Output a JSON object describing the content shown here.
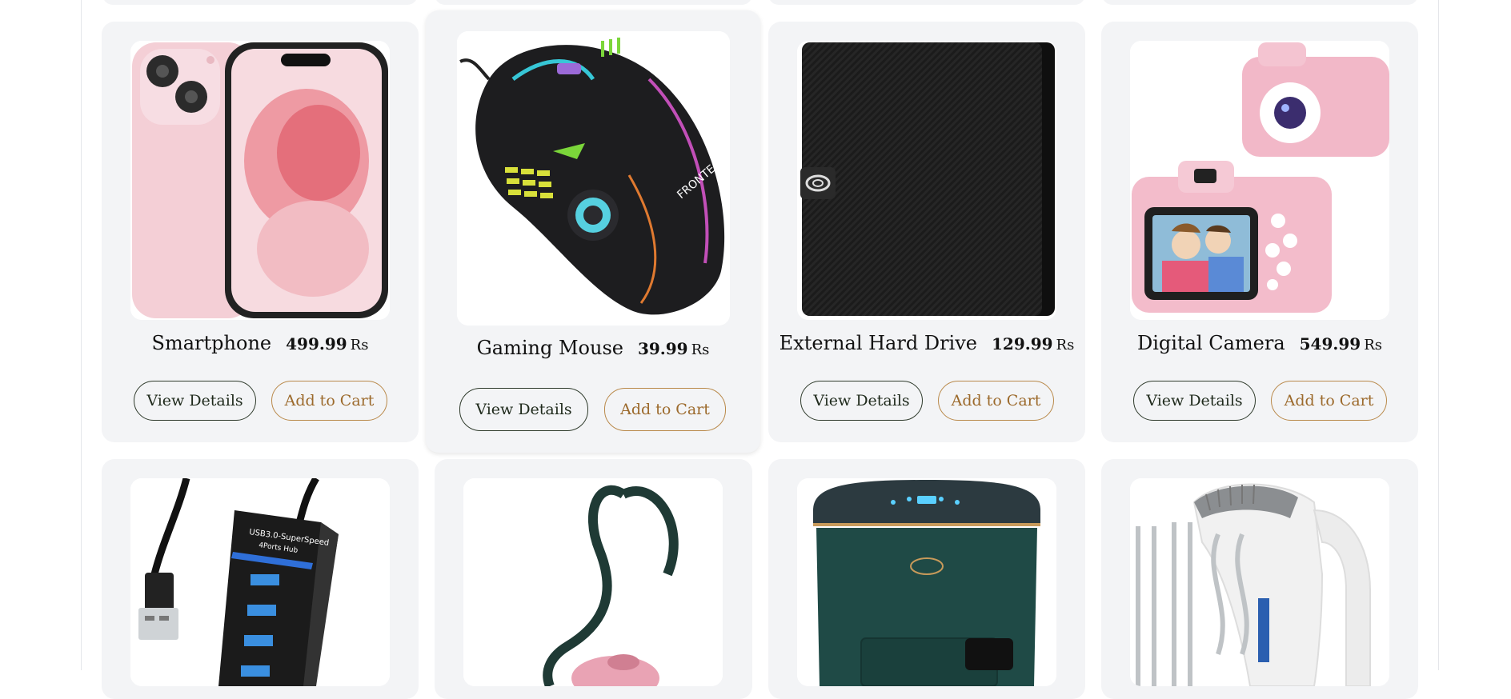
{
  "products": [
    {
      "name": "Smartphone",
      "price": "499.99",
      "currency": "Rs",
      "view_label": "View Details",
      "cart_label": "Add to Cart",
      "image_icon": "smartphone-image"
    },
    {
      "name": "Gaming Mouse",
      "price": "39.99",
      "currency": "Rs",
      "view_label": "View Details",
      "cart_label": "Add to Cart",
      "image_icon": "gaming-mouse-image"
    },
    {
      "name": "External Hard Drive",
      "price": "129.99",
      "currency": "Rs",
      "view_label": "View Details",
      "cart_label": "Add to Cart",
      "image_icon": "hard-drive-image"
    },
    {
      "name": "Digital Camera",
      "price": "549.99",
      "currency": "Rs",
      "view_label": "View Details",
      "cart_label": "Add to Cart",
      "image_icon": "camera-image"
    }
  ],
  "next_row_images": [
    "usb-hub-image",
    "vacuum-cleaner-image",
    "air-fryer-image",
    "hand-mixer-image"
  ],
  "colors": {
    "card_bg": "#f3f4f6",
    "view_border": "#2f3b2c",
    "cart_border": "#b9894a",
    "cart_text": "#9c6a2c"
  }
}
